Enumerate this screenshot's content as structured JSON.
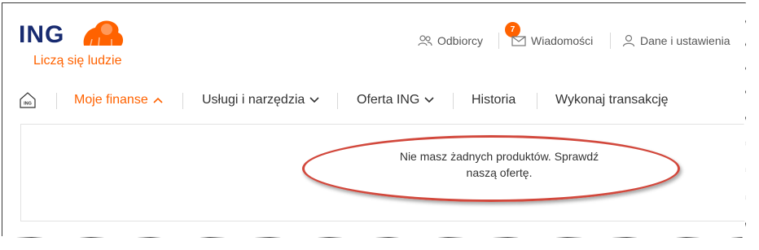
{
  "brand": {
    "name": "ING",
    "tagline": "Liczą się ludzie",
    "primary_color": "#182b70",
    "accent_color": "#ff6200"
  },
  "top_nav": {
    "recipients": {
      "label": "Odbiorcy",
      "icon": "users-icon"
    },
    "messages": {
      "label": "Wiadomości",
      "icon": "envelope-icon",
      "badge": "7"
    },
    "settings": {
      "label": "Dane i ustawienia",
      "icon": "user-icon"
    }
  },
  "main_nav": {
    "home_icon_label": "ING",
    "tabs": [
      {
        "label": "Moje finanse",
        "active": true,
        "chevron": "chevron-up-icon"
      },
      {
        "label": "Usługi i narzędzia",
        "chevron": "chevron-down-icon"
      },
      {
        "label": "Oferta ING",
        "chevron": "chevron-down-icon"
      },
      {
        "label": "Historia"
      },
      {
        "label": "Wykonaj transakcję"
      }
    ]
  },
  "content": {
    "message_line1": "Nie masz żadnych produktów. Sprawdź",
    "message_line2": "naszą ofertę."
  }
}
